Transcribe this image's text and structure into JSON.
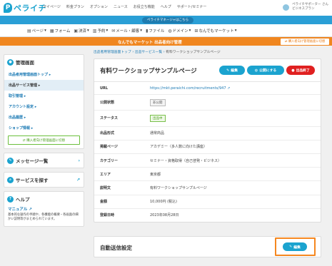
{
  "header": {
    "logo_text": "ペライチ",
    "nav": [
      "マイページ",
      "料金プラン",
      "オプション",
      "ニュース",
      "お役立ち機能",
      "ヘルプ",
      "サポート/セミナー"
    ],
    "user_name": "ペライチサポーター さん",
    "user_plan": "ビジネスプラン"
  },
  "bluebar": {
    "button": "ペライチマネージャはこちら"
  },
  "categories": [
    "ページ",
    "フォーム",
    "決済",
    "予約",
    "メール・顧客",
    "ファイル",
    "ドメイン",
    "なんでもマーケット"
  ],
  "orangebar": {
    "text": "なんでもマーケット 出品者向け管理",
    "button": "購入者向け管理画面に切替"
  },
  "sidebar": {
    "admin_title": "管理画面",
    "items": [
      {
        "label": "出品者用管理画面トップ"
      },
      {
        "label": "出品サービス管理"
      },
      {
        "label": "取引管理"
      },
      {
        "label": "アカウント設定"
      },
      {
        "label": "出品履歴"
      },
      {
        "label": "ショップ情報"
      }
    ],
    "switch_label": "購入者向け管理画面に切替",
    "messages_title": "メッセージ一覧",
    "search_title": "サービスを探す",
    "help_title": "ヘルプ",
    "manual_label": "マニュアル",
    "manual_desc": "基本的な操作の手順や、各機能の概要・各画面の細かい説明等がまとめられています。"
  },
  "breadcrumb": {
    "items": [
      "出品者用管理画面トップ",
      "出品サービス一覧"
    ],
    "current": "有料ワークショップサンプルページ"
  },
  "service": {
    "title": "有料ワークショップサンプルページ",
    "edit_label": "編集",
    "publish_label": "公開にする",
    "end_label": "出品終了",
    "rows": [
      {
        "key": "URL",
        "value": "https://mkt.peraichi.com/recruitments/947"
      },
      {
        "key": "公開状態",
        "value": "非公開"
      },
      {
        "key": "ステータス",
        "value": "出品中"
      },
      {
        "key": "出品形式",
        "value": "通常商品"
      },
      {
        "key": "掲載ページ",
        "value": "アカデミー（多人数に向けた講座）"
      },
      {
        "key": "カテゴリー",
        "value": "セミナー・資格取得（自己啓発・ビジネス）"
      },
      {
        "key": "エリア",
        "value": "東京都"
      },
      {
        "key": "説明文",
        "value": "有料ワークショップサンプルページ"
      },
      {
        "key": "金額",
        "value": "10,000円 (税込)"
      },
      {
        "key": "登録日時",
        "value": "2023年08月28日"
      }
    ]
  },
  "auto_send": {
    "title": "自動送信設定",
    "edit_label": "編集"
  },
  "colors": {
    "brand": "#1ba3cf",
    "orange": "#f0861f",
    "danger": "#e02020"
  }
}
